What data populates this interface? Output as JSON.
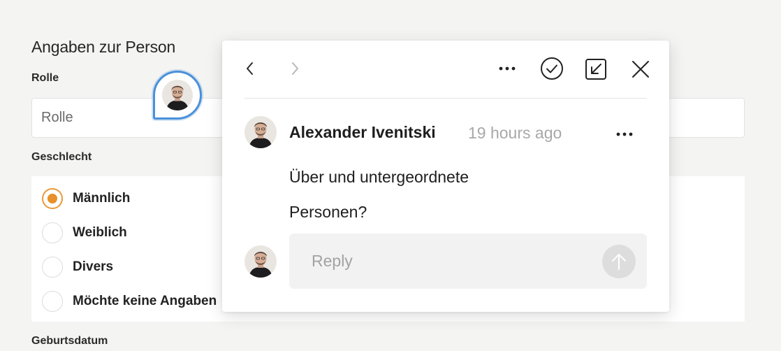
{
  "form": {
    "section_title": "Angaben zur Person",
    "role_label": "Rolle",
    "role_placeholder": "Rolle",
    "gender_label": "Geschlecht",
    "gender_options": [
      {
        "label": "Männlich",
        "checked": true
      },
      {
        "label": "Weiblich",
        "checked": false
      },
      {
        "label": "Divers",
        "checked": false
      },
      {
        "label": "Möchte keine Angaben",
        "checked": false
      }
    ],
    "birthdate_label": "Geburtsdatum"
  },
  "comment_marker": {
    "avatar": "user-avatar",
    "accent_color": "#4a90d9"
  },
  "comment_popup": {
    "toolbar": {
      "prev_icon": "chevron-left-icon",
      "next_icon": "chevron-right-icon",
      "more_icon": "more-horizontal-icon",
      "resolve_icon": "check-circle-icon",
      "expand_icon": "open-in-panel-icon",
      "close_icon": "close-icon"
    },
    "comment": {
      "author": "Alexander Ivenitski",
      "time": "19 hours ago",
      "text_line1": "Über und untergeordnete",
      "text_line2": "Personen?"
    },
    "reply": {
      "placeholder": "Reply",
      "send_icon": "arrow-up-icon"
    }
  },
  "colors": {
    "radio_accent": "#e8902a",
    "marker_border": "#4a90d9",
    "muted_text": "#a8a8a8"
  }
}
